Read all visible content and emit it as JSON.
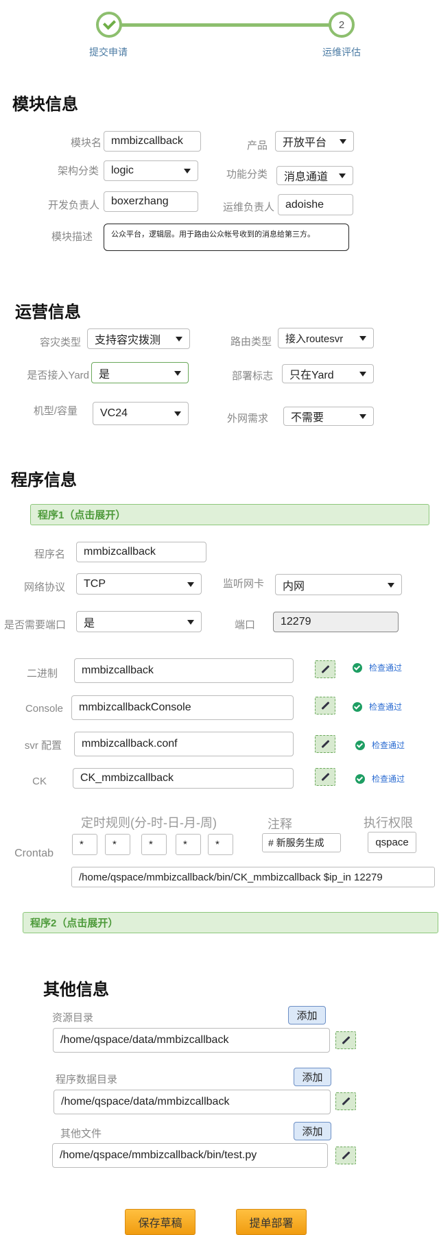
{
  "steps": [
    {
      "label": "提交申请",
      "state": "done"
    },
    {
      "label": "运维评估",
      "number": "2"
    }
  ],
  "module": {
    "title": "模块信息",
    "name_label": "模块名",
    "name_value": "mmbizcallback",
    "product_label": "产品",
    "product_value": "开放平台",
    "arch_label": "架构分类",
    "arch_value": "logic",
    "func_label": "功能分类",
    "func_value": "消息通道",
    "dev_owner_label": "开发负责人",
    "dev_owner_value": "boxerzhang",
    "ops_owner_label": "运维负责人",
    "ops_owner_value": "adoishe",
    "desc_label": "模块描述",
    "desc_value": "公众平台，逻辑层。用于路由公众帐号收到的消息给第三方。"
  },
  "ops": {
    "title": "运营信息",
    "dr_label": "容灾类型",
    "dr_value": "支持容灾拨测",
    "route_label": "路由类型",
    "route_value": "接入routesvr",
    "yard_label": "是否接入Yard",
    "yard_value": "是",
    "deploy_label": "部署标志",
    "deploy_value": "只在Yard",
    "model_label": "机型/容量",
    "model_value": "VC24",
    "extnet_label": "外网需求",
    "extnet_value": "不需要"
  },
  "program": {
    "title": "程序信息",
    "p1_header": "程序1（点击展开）",
    "name_label": "程序名",
    "name_value": "mmbizcallback",
    "proto_label": "网络协议",
    "proto_value": "TCP",
    "nic_label": "监听网卡",
    "nic_value": "内网",
    "needport_label": "是否需要端口",
    "needport_value": "是",
    "port_label": "端口",
    "port_value": "12279",
    "binary_label": "二进制",
    "binary_value": "mmbizcallback",
    "console_label": "Console",
    "console_value": "mmbizcallbackConsole",
    "svrconf_label": "svr 配置",
    "svrconf_value": "mmbizcallback.conf",
    "ck_label": "CK",
    "ck_value": "CK_mmbizcallback",
    "check_text": "检查通过",
    "cron_rule_label": "定时规则(分-时-日-月-周)",
    "cron_note_label": "注释",
    "cron_perm_label": "执行权限",
    "crontab_label": "Crontab",
    "cron_fields": [
      "*",
      "*",
      "*",
      "*",
      "*"
    ],
    "cron_note_value": "# 新服务生成",
    "cron_perm_value": "qspace",
    "cron_cmd_value": "/home/qspace/mmbizcallback/bin/CK_mmbizcallback $ip_in 12279",
    "p2_header": "程序2（点击展开）"
  },
  "other": {
    "title": "其他信息",
    "res_label": "资源目录",
    "res_value": "/home/qspace/data/mmbizcallback",
    "data_label": "程序数据目录",
    "data_value": "/home/qspace/data/mmbizcallback",
    "files_label": "其他文件",
    "files_value": "/home/qspace/mmbizcallback/bin/test.py",
    "add_label": "添加"
  },
  "actions": {
    "save_label": "保存草稿",
    "submit_label": "提单部署"
  },
  "colors": {
    "step_green": "#8dbf6e",
    "section_green": "#dff0d8",
    "add_blue": "#dbe8f8",
    "button_orange": "#f5a623",
    "check_green": "#1e9e63"
  }
}
